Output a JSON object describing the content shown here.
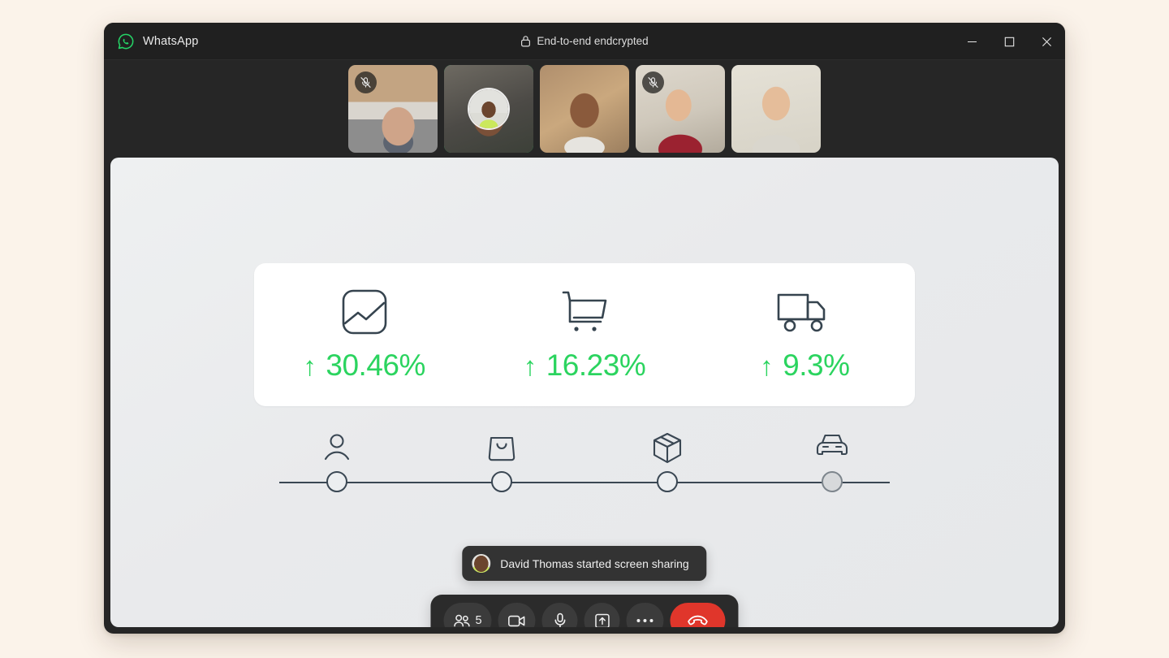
{
  "window": {
    "app_name": "WhatsApp",
    "logo_icon": "whatsapp-logo-icon",
    "encryption_label": "End-to-end endcrypted",
    "lock_icon": "lock-icon",
    "controls": {
      "minimize": "minimize-icon",
      "maximize": "maximize-icon",
      "close": "close-icon"
    }
  },
  "participants": [
    {
      "id": 1,
      "muted": true,
      "camera_on": true,
      "speaking": false,
      "mic_icon": "mic-off-icon"
    },
    {
      "id": 2,
      "muted": false,
      "camera_on": false,
      "speaking": true,
      "mic_icon": ""
    },
    {
      "id": 3,
      "muted": false,
      "camera_on": true,
      "speaking": false,
      "mic_icon": ""
    },
    {
      "id": 4,
      "muted": true,
      "camera_on": true,
      "speaking": false,
      "mic_icon": "mic-off-icon"
    },
    {
      "id": 5,
      "muted": false,
      "camera_on": true,
      "speaking": false,
      "mic_icon": ""
    }
  ],
  "shared_screen": {
    "metrics": [
      {
        "icon": "chart-image-icon",
        "trend": "up",
        "arrow": "↑",
        "value": "30.46%"
      },
      {
        "icon": "shopping-cart-icon",
        "trend": "up",
        "arrow": "↑",
        "value": "16.23%"
      },
      {
        "icon": "delivery-truck-icon",
        "trend": "up",
        "arrow": "↑",
        "value": "9.3%"
      }
    ],
    "timeline": {
      "steps": [
        {
          "icon": "person-icon",
          "state": "open"
        },
        {
          "icon": "shopping-bag-icon",
          "state": "open"
        },
        {
          "icon": "package-box-icon",
          "state": "open"
        },
        {
          "icon": "car-icon",
          "state": "filled"
        }
      ]
    },
    "accent_green": "#2BD45F",
    "ink": "#3a4753",
    "card_background": "#ffffff",
    "stage_background": "#e9eaec"
  },
  "toast": {
    "avatar": "participant-avatar",
    "message": "David Thomas started screen sharing"
  },
  "controlbar": {
    "buttons": [
      {
        "name": "participants-button",
        "icon": "people-icon",
        "label": "5"
      },
      {
        "name": "camera-button",
        "icon": "video-camera-icon",
        "label": ""
      },
      {
        "name": "microphone-button",
        "icon": "microphone-icon",
        "label": ""
      },
      {
        "name": "share-screen-button",
        "icon": "share-screen-icon",
        "label": ""
      },
      {
        "name": "more-options-button",
        "icon": "ellipsis-icon",
        "label": ""
      },
      {
        "name": "end-call-button",
        "icon": "phone-hangup-icon",
        "label": ""
      }
    ],
    "end_call_color": "#e0362b"
  }
}
